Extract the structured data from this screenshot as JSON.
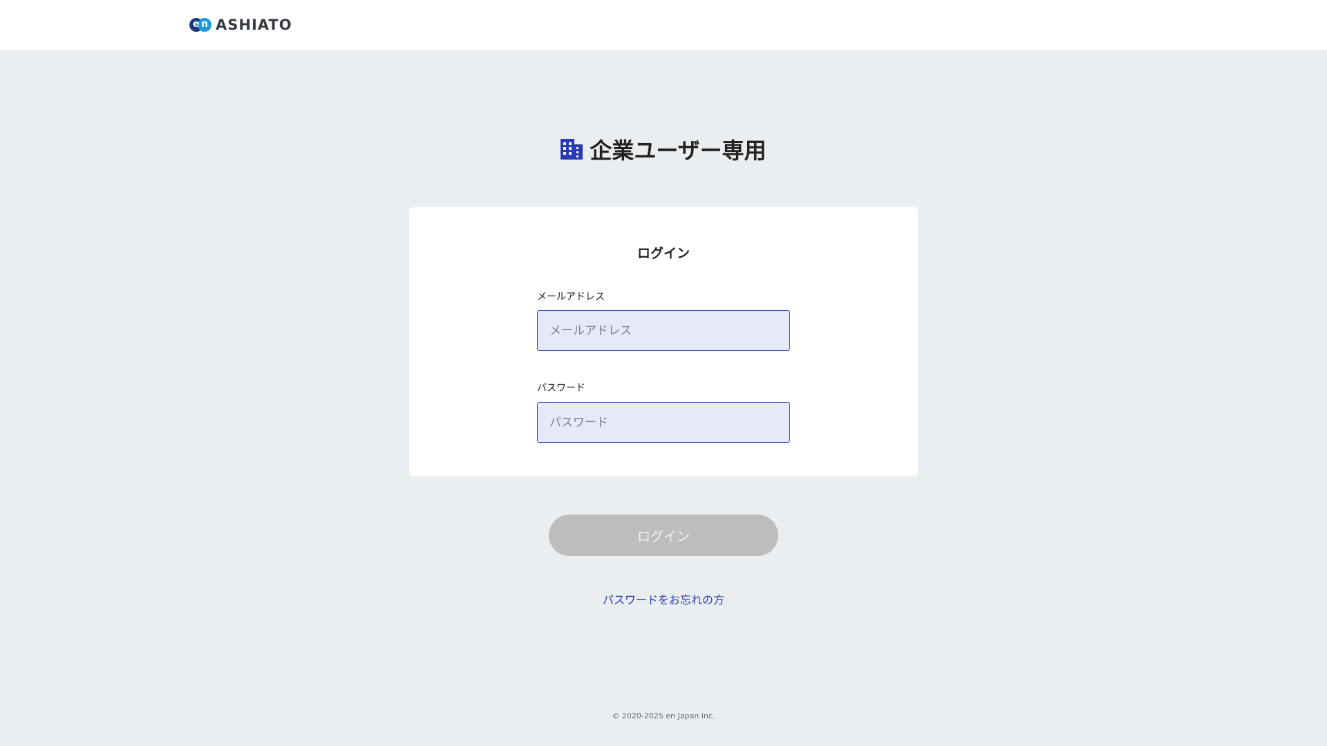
{
  "header": {
    "logo_mark": {
      "left": "e",
      "right": "n"
    },
    "logo_text": "ASHIATO"
  },
  "page_title": {
    "icon": "building-icon",
    "text": "企業ユーザー専用"
  },
  "login_form": {
    "title": "ログイン",
    "email_label": "メールアドレス",
    "email_placeholder": "メールアドレス",
    "email_value": "",
    "password_label": "パスワード",
    "password_placeholder": "パスワード",
    "password_value": ""
  },
  "login_button": {
    "label": "ログイン",
    "enabled": false
  },
  "forgot_password_link": "パスワードをお忘れの方",
  "footer": {
    "copyright": "© 2020-2025 en Japan Inc."
  },
  "colors": {
    "background": "#ebeef1",
    "accent": "#2a3ab5",
    "input_fill": "#e6e9fa",
    "button_disabled": "#bcbdbf",
    "logo_dark": "#1b3a7a",
    "logo_light": "#1f9bd8"
  }
}
